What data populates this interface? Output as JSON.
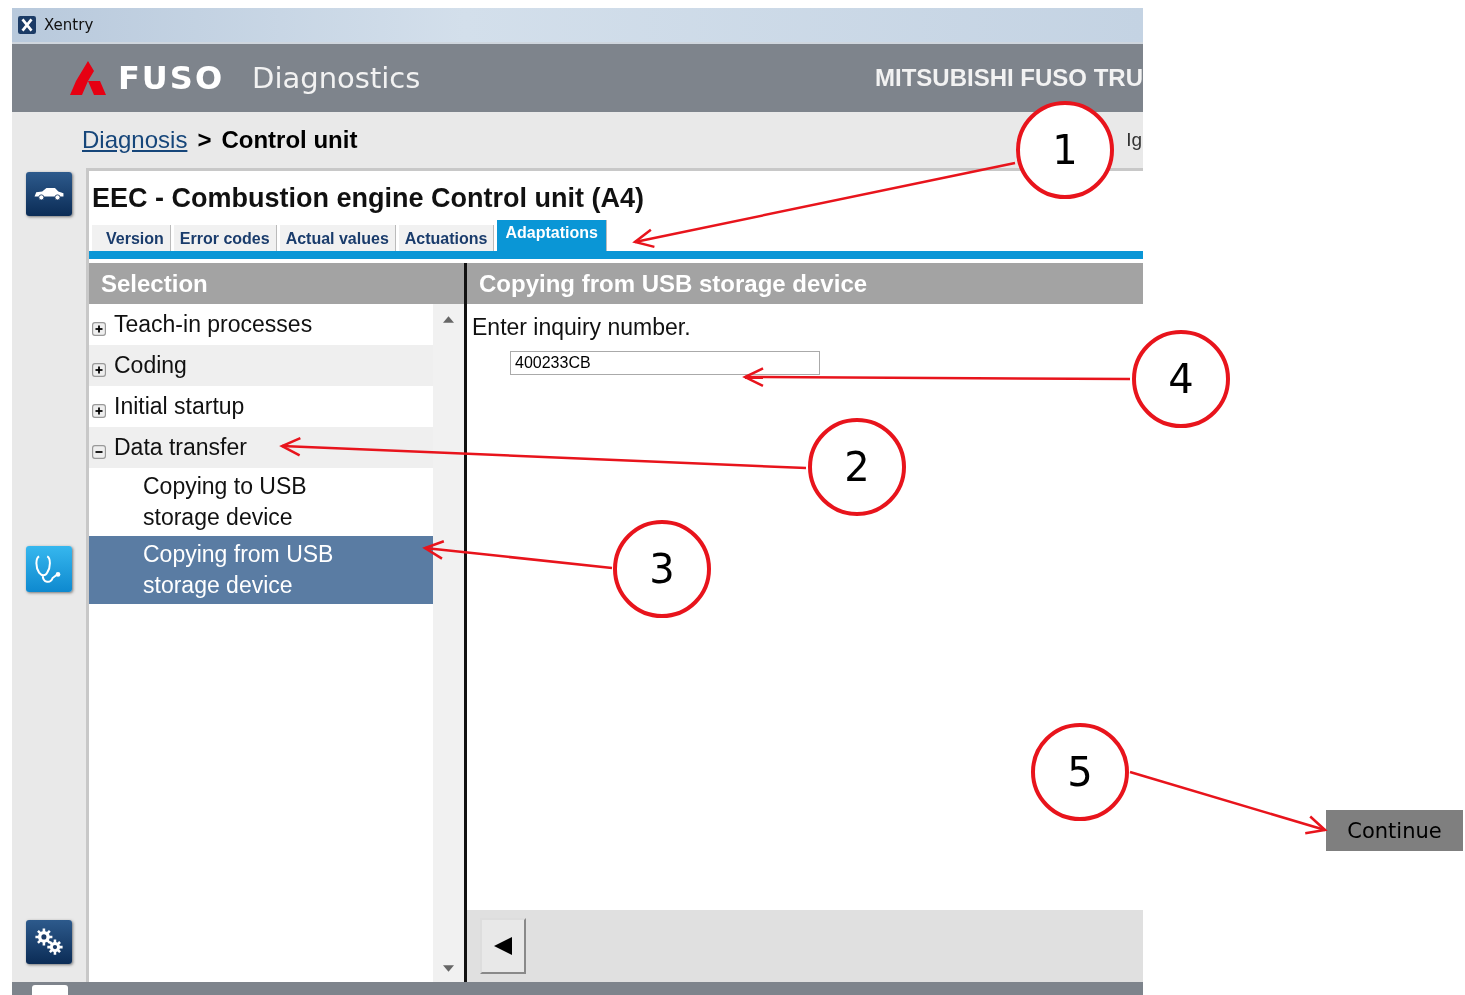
{
  "window": {
    "title": "Xentry"
  },
  "header": {
    "brand": "FUSO",
    "product": "Diagnostics",
    "company": "MITSUBISHI FUSO TRU"
  },
  "breadcrumb": {
    "link": "Diagnosis",
    "separator": ">",
    "current": "Control unit"
  },
  "toolbar_text": "Ig",
  "panel": {
    "title": "EEC - Combustion engine Control unit (A4)"
  },
  "tabs": [
    {
      "label": "Version",
      "selected": false
    },
    {
      "label": "Error codes",
      "selected": false
    },
    {
      "label": "Actual values",
      "selected": false
    },
    {
      "label": "Actuations",
      "selected": false
    },
    {
      "label": "Adaptations",
      "selected": true
    }
  ],
  "selection": {
    "title": "Selection",
    "items": [
      {
        "label": "Teach-in processes",
        "expanded": false,
        "selected": false
      },
      {
        "label": "Coding",
        "expanded": false,
        "selected": false
      },
      {
        "label": "Initial startup",
        "expanded": false,
        "selected": false
      },
      {
        "label": "Data transfer",
        "expanded": true,
        "selected": false,
        "children": [
          {
            "label": "Copying to USB storage device",
            "selected": false
          },
          {
            "label": "Copying from USB storage device",
            "selected": true
          }
        ]
      }
    ]
  },
  "content": {
    "title": "Copying from USB storage device",
    "prompt": "Enter inquiry number.",
    "input_value": "400233CB"
  },
  "annotations": [
    {
      "label": "1"
    },
    {
      "label": "2"
    },
    {
      "label": "3"
    },
    {
      "label": "4"
    },
    {
      "label": "5"
    }
  ],
  "continue_button": "Continue"
}
